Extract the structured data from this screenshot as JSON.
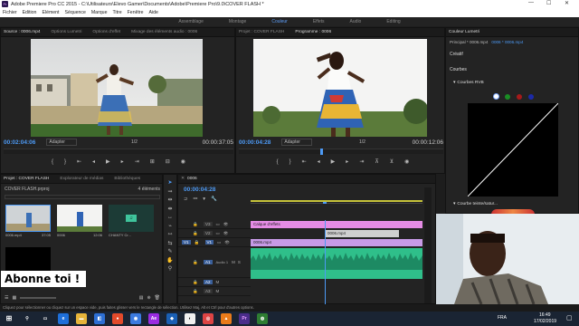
{
  "window": {
    "title": "Adobe Premiere Pro CC 2015 - C:\\Utilisateurs\\Elevo Gamer\\Documents\\Adobe\\Premiere Pro\\9.0\\COVER FLASH *"
  },
  "menu": [
    "Fichier",
    "Edition",
    "Elément",
    "Séquence",
    "Marque",
    "Titre",
    "Fenêtre",
    "Aide"
  ],
  "workspaces": [
    {
      "label": "Assemblage",
      "active": false
    },
    {
      "label": "Montage",
      "active": false
    },
    {
      "label": "Couleur",
      "active": true
    },
    {
      "label": "Effets",
      "active": false
    },
    {
      "label": "Audio",
      "active": false
    },
    {
      "label": "Editing",
      "active": false
    }
  ],
  "source": {
    "tabs": [
      "Source : 0006.mp4",
      "Options Lumetri",
      "Options d'effet",
      "Mixage des éléments audio : 0006"
    ],
    "timecode": "00:02:04:06",
    "fit": "Adapter",
    "scale": "1/2",
    "duration": "00:00:37:05"
  },
  "program": {
    "tabs": [
      "Projet : COVER FLASH",
      "Programme : 0006"
    ],
    "timecode": "00:00:04:28",
    "fit": "Adapter",
    "scale": "1/2",
    "duration": "00:00:12:06"
  },
  "lumetri": {
    "tab": "Couleur Lumetri",
    "target": "Principal * 0006.mp4",
    "target_seq": "0006 * 0006.mp4",
    "sections": [
      "Créatif",
      "Courbes",
      "Courbes RVB",
      "Courbe teinte/satur..."
    ]
  },
  "project": {
    "tabs": [
      "Projet : COVER FLASH",
      "Explorateur de médias",
      "Bibliothèques"
    ],
    "file": "COVER FLASH.prproj",
    "count": "4 éléments",
    "items": [
      {
        "name": "0006.mp4",
        "dur": "37:05"
      },
      {
        "name": "0006",
        "dur": "12:06"
      },
      {
        "name": "CHANTY Cr...",
        "dur": "4:16:00593"
      }
    ]
  },
  "timeline": {
    "tab": "0006",
    "timecode": "00:00:04:28",
    "tracks_video": [
      "V3",
      "V2",
      "V1"
    ],
    "tracks_audio": [
      "A1",
      "A2",
      "A3"
    ],
    "audio_label": "Audio 1",
    "clips": {
      "adjust": "Calque d'effets",
      "v2": "0006.mp4",
      "v1": "0006.mp4"
    }
  },
  "overlay": {
    "text": "Abonne toi !"
  },
  "statusbar": "Cliquez pour sélectionner ou cliquez sur un espace vide, puis faites glisser vers le rectangle de sélection. Utilisez Maj, Alt et Ctrl pour d'autres options.",
  "taskbar": {
    "lang": "FRA",
    "time": "16:49",
    "date": "17/02/2019"
  }
}
